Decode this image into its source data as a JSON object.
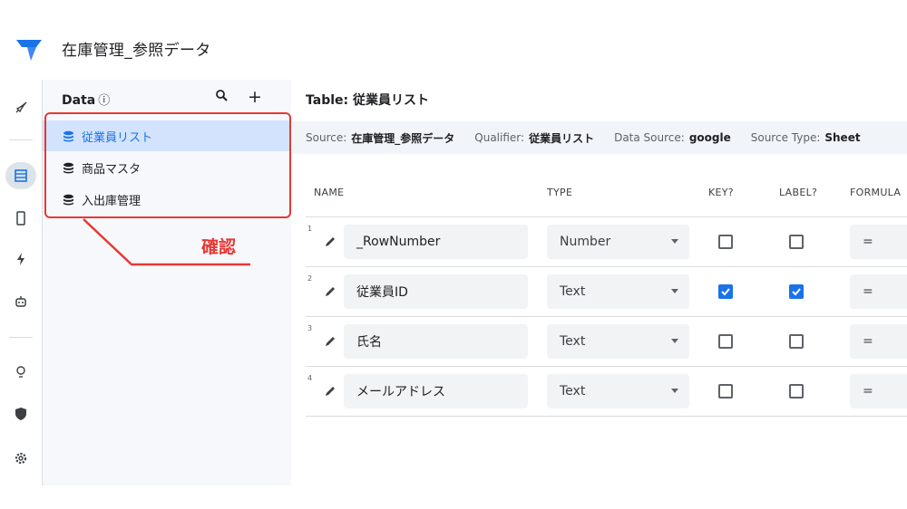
{
  "app": {
    "title": "在庫管理_参照データ"
  },
  "data_panel": {
    "heading": "Data",
    "info_icon": "ⓘ",
    "search_icon": "search-icon",
    "add_icon": "+",
    "tables": [
      {
        "label": "従業員リスト",
        "selected": true
      },
      {
        "label": "商品マスタ",
        "selected": false
      },
      {
        "label": "入出庫管理",
        "selected": false
      }
    ]
  },
  "annotation": {
    "text": "確認",
    "color": "#e53935"
  },
  "main": {
    "title": "Table: 従業員リスト",
    "source_bar": {
      "source_label": "Source:",
      "source_value": "在庫管理_参照データ",
      "qualifier_label": "Qualifier:",
      "qualifier_value": "従業員リスト",
      "data_source_label": "Data Source:",
      "data_source_value": "google",
      "source_type_label": "Source Type:",
      "source_type_value": "Sheet"
    },
    "columns": {
      "name": "NAME",
      "type": "TYPE",
      "key": "KEY?",
      "label": "LABEL?",
      "formula": "FORMULA"
    },
    "rows": [
      {
        "num": "1",
        "name": "_RowNumber",
        "type": "Number",
        "key": false,
        "label": false,
        "formula": "="
      },
      {
        "num": "2",
        "name": "従業員ID",
        "type": "Text",
        "key": true,
        "label": true,
        "formula": "="
      },
      {
        "num": "3",
        "name": "氏名",
        "type": "Text",
        "key": false,
        "label": false,
        "formula": "="
      },
      {
        "num": "4",
        "name": "メールアドレス",
        "type": "Text",
        "key": false,
        "label": false,
        "formula": "="
      }
    ]
  },
  "colors": {
    "accent": "#1a73e8",
    "selected_bg": "#d3e3fd",
    "annotation": "#e53935"
  }
}
